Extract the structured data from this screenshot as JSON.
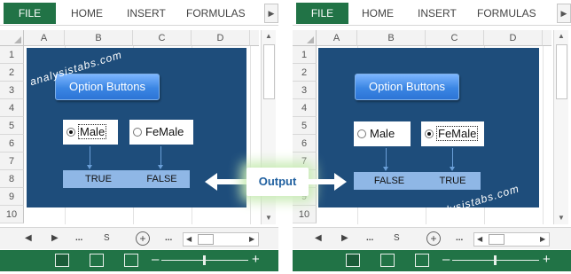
{
  "ribbon_tabs": [
    "FILE",
    "HOME",
    "INSERT",
    "FORMULAS"
  ],
  "columns": [
    "A",
    "B",
    "C",
    "D"
  ],
  "rows": [
    "1",
    "2",
    "3",
    "4",
    "5",
    "6",
    "7",
    "8",
    "9",
    "10"
  ],
  "button_label": "Option Buttons",
  "watermark": "analysistabs.com",
  "callout": "Output",
  "left": {
    "options": [
      {
        "label": "Male",
        "selected": true
      },
      {
        "label": "FeMale",
        "selected": false
      }
    ],
    "results": [
      "TRUE",
      "FALSE"
    ]
  },
  "right": {
    "options": [
      {
        "label": "Male",
        "selected": false
      },
      {
        "label": "FeMale",
        "selected": true
      }
    ],
    "results": [
      "FALSE",
      "TRUE"
    ]
  },
  "sheetbar": {
    "ellipsis": "...",
    "sheet_stub": "S"
  },
  "colors": {
    "excel_green": "#217346",
    "sheet_blue": "#1e4d7b",
    "result_blue": "#8fb7e6"
  }
}
